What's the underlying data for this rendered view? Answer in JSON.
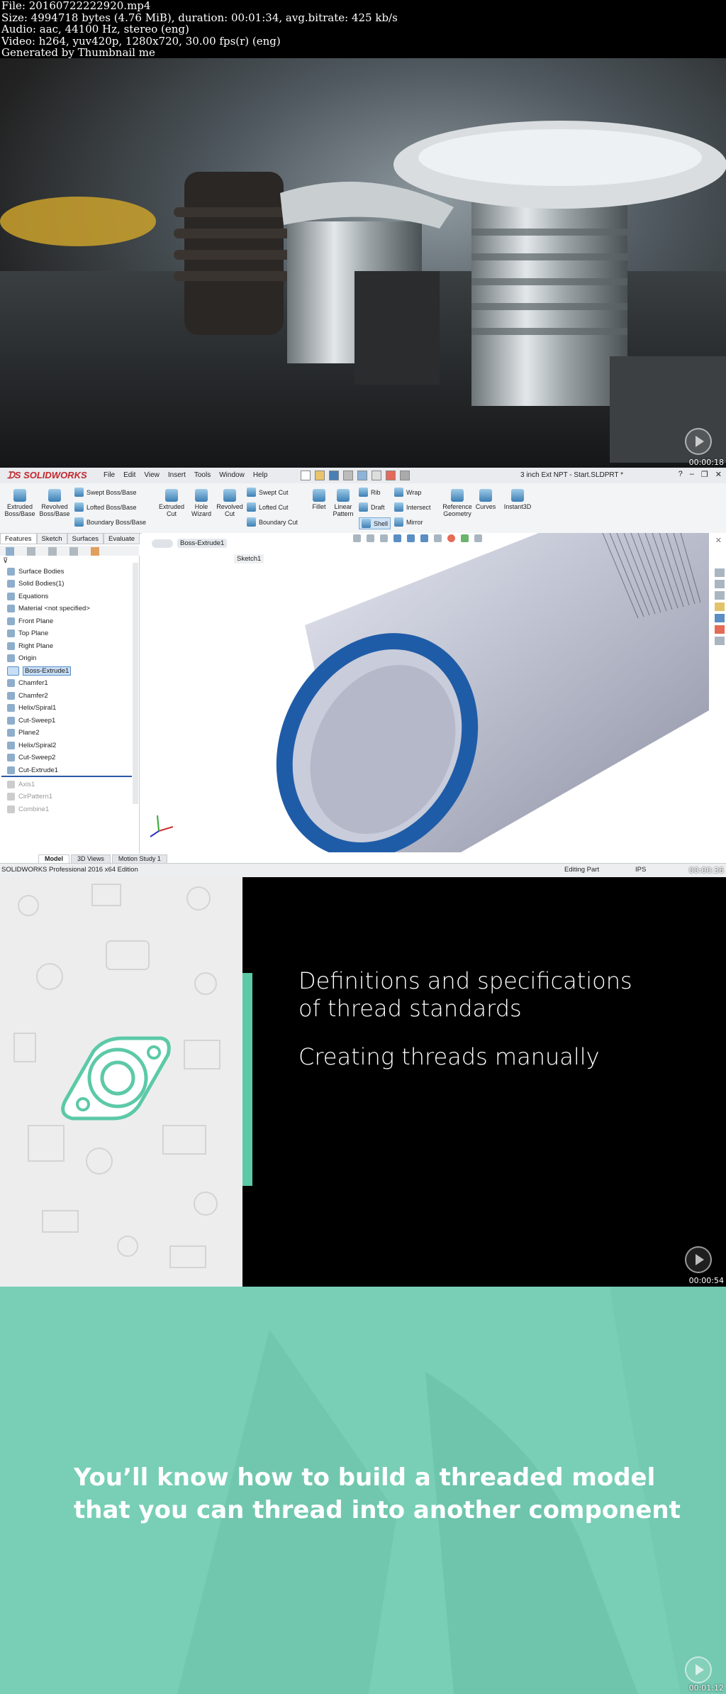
{
  "header": {
    "file": "File: 20160722222920.mp4",
    "size": "Size: 4994718 bytes (4.76 MiB), duration: 00:01:34, avg.bitrate: 425 kb/s",
    "audio": "Audio: aac, 44100 Hz, stereo (eng)",
    "video": "Video: h264, yuv420p, 1280x720, 30.00 fps(r) (eng)",
    "generated": "Generated by Thumbnail me"
  },
  "frames": [
    {
      "timestamp": "00:00:18"
    },
    {
      "timestamp": "00:00:36"
    },
    {
      "timestamp": "00:00:54"
    },
    {
      "timestamp": "00:01:12"
    }
  ],
  "solidworks": {
    "logo": "SOLIDWORKS",
    "menu": [
      "File",
      "Edit",
      "View",
      "Insert",
      "Tools",
      "Window",
      "Help"
    ],
    "document_title": "3 inch Ext NPT - Start.SLDPRT *",
    "ribbon": {
      "extruded_boss": "Extruded Boss/Base",
      "revolved_boss": "Revolved Boss/Base",
      "swept_boss": "Swept Boss/Base",
      "lofted_boss": "Lofted Boss/Base",
      "boundary_boss": "Boundary Boss/Base",
      "extruded_cut": "Extruded Cut",
      "hole_wizard": "Hole Wizard",
      "revolved_cut": "Revolved Cut",
      "swept_cut": "Swept Cut",
      "lofted_cut": "Lofted Cut",
      "boundary_cut": "Boundary Cut",
      "fillet": "Fillet",
      "linear_pattern": "Linear Pattern",
      "rib": "Rib",
      "draft": "Draft",
      "shell": "Shell",
      "wrap": "Wrap",
      "intersect": "Intersect",
      "mirror": "Mirror",
      "reference_geometry": "Reference Geometry",
      "curves": "Curves",
      "instant3d": "Instant3D"
    },
    "tabs": [
      "Features",
      "Sketch",
      "Surfaces",
      "Evaluate"
    ],
    "tree": [
      "Surface Bodies",
      "Solid Bodies(1)",
      "Equations",
      "Material <not specified>",
      "Front Plane",
      "Top Plane",
      "Right Plane",
      "Origin",
      "Boss-Extrude1",
      "Chamfer1",
      "Chamfer2",
      "Helix/Spiral1",
      "Cut-Sweep1",
      "Plane2",
      "Helix/Spiral2",
      "Cut-Sweep2",
      "Cut-Extrude1",
      "Axis1",
      "CirPattern1",
      "Combine1"
    ],
    "breadcrumb_feature": "Boss-Extrude1",
    "breadcrumb_sketch": "Sketch1",
    "bottom_tabs": [
      "Model",
      "3D Views",
      "Motion Study 1"
    ],
    "status_left": "SOLIDWORKS Professional 2016 x64 Edition",
    "status_editing": "Editing Part",
    "status_units": "IPS"
  },
  "course": {
    "line1": "Definitions and specifications",
    "line2": "of thread standards",
    "line3": "Creating threads manually"
  },
  "outcome": {
    "line1": "You’ll know how to build a threaded model",
    "line2": "that you can thread into another component"
  }
}
